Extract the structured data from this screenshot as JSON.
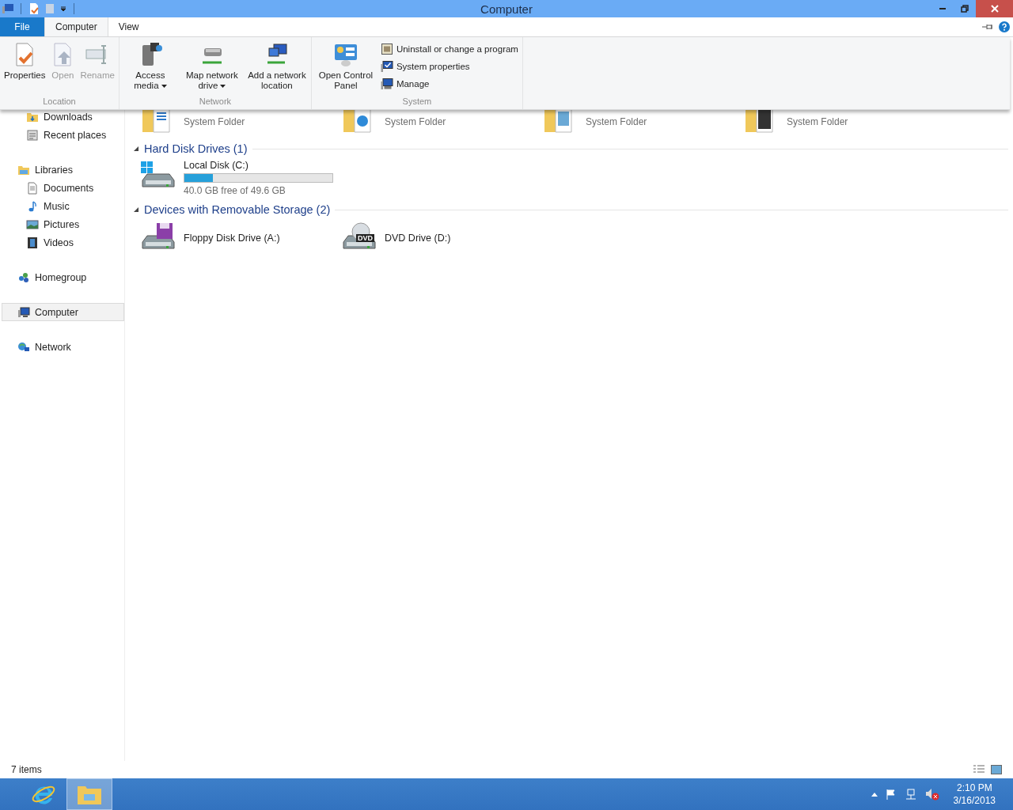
{
  "window": {
    "title": "Computer"
  },
  "tabs": [
    {
      "label": "File",
      "kind": "file",
      "selected": false
    },
    {
      "label": "Computer",
      "kind": "tab",
      "selected": true
    },
    {
      "label": "View",
      "kind": "tab",
      "selected": false
    }
  ],
  "ribbon": {
    "groups": [
      {
        "label": "Location",
        "buttons": [
          {
            "label": "Properties",
            "disabled": false,
            "dropdown": false
          },
          {
            "label": "Open",
            "disabled": true,
            "dropdown": false
          },
          {
            "label": "Rename",
            "disabled": true,
            "dropdown": false
          }
        ]
      },
      {
        "label": "Network",
        "buttons": [
          {
            "label": "Access media",
            "disabled": false,
            "dropdown": true
          },
          {
            "label": "Map network drive",
            "disabled": false,
            "dropdown": true
          },
          {
            "label": "Add a network location",
            "disabled": false,
            "dropdown": false
          }
        ]
      },
      {
        "label": "System",
        "buttons": [
          {
            "label": "Open Control Panel",
            "disabled": false,
            "dropdown": false
          }
        ],
        "small_buttons": [
          {
            "label": "Uninstall or change a program"
          },
          {
            "label": "System properties"
          },
          {
            "label": "Manage"
          }
        ]
      }
    ]
  },
  "sidebar": {
    "favorites": [
      {
        "label": "Downloads",
        "selected": false
      },
      {
        "label": "Recent places",
        "selected": false
      }
    ],
    "items": [
      {
        "label": "Libraries",
        "selected": false,
        "children": [
          {
            "label": "Documents",
            "selected": false
          },
          {
            "label": "Music",
            "selected": false
          },
          {
            "label": "Pictures",
            "selected": false
          },
          {
            "label": "Videos",
            "selected": false
          }
        ]
      },
      {
        "label": "Homegroup",
        "selected": false
      },
      {
        "label": "Computer",
        "selected": true
      },
      {
        "label": "Network",
        "selected": false
      }
    ]
  },
  "folders": [
    {
      "kind": "documents",
      "subtitle": "System Folder"
    },
    {
      "kind": "music",
      "subtitle": "System Folder"
    },
    {
      "kind": "pictures",
      "subtitle": "System Folder"
    },
    {
      "kind": "videos",
      "subtitle": "System Folder"
    }
  ],
  "sections": [
    {
      "heading": "Hard Disk Drives (1)",
      "expanded": true,
      "items": [
        {
          "kind": "hdd",
          "name": "Local Disk (C:)",
          "level": 0.19,
          "detail": "40.0 GB free of 49.6 GB"
        }
      ]
    },
    {
      "heading": "Devices with Removable Storage (2)",
      "expanded": true,
      "items": [
        {
          "kind": "floppy",
          "name": "Floppy Disk Drive (A:)"
        },
        {
          "kind": "dvd",
          "name": "DVD Drive (D:)",
          "badge": "DVD"
        }
      ]
    }
  ],
  "status_bar": {
    "text": "7 items"
  },
  "taskbar": {
    "apps": [
      {
        "kind": "ie",
        "selected": false
      },
      {
        "kind": "explorer",
        "selected": true
      }
    ],
    "time": "2:10 PM",
    "date": "3/16/2013"
  }
}
